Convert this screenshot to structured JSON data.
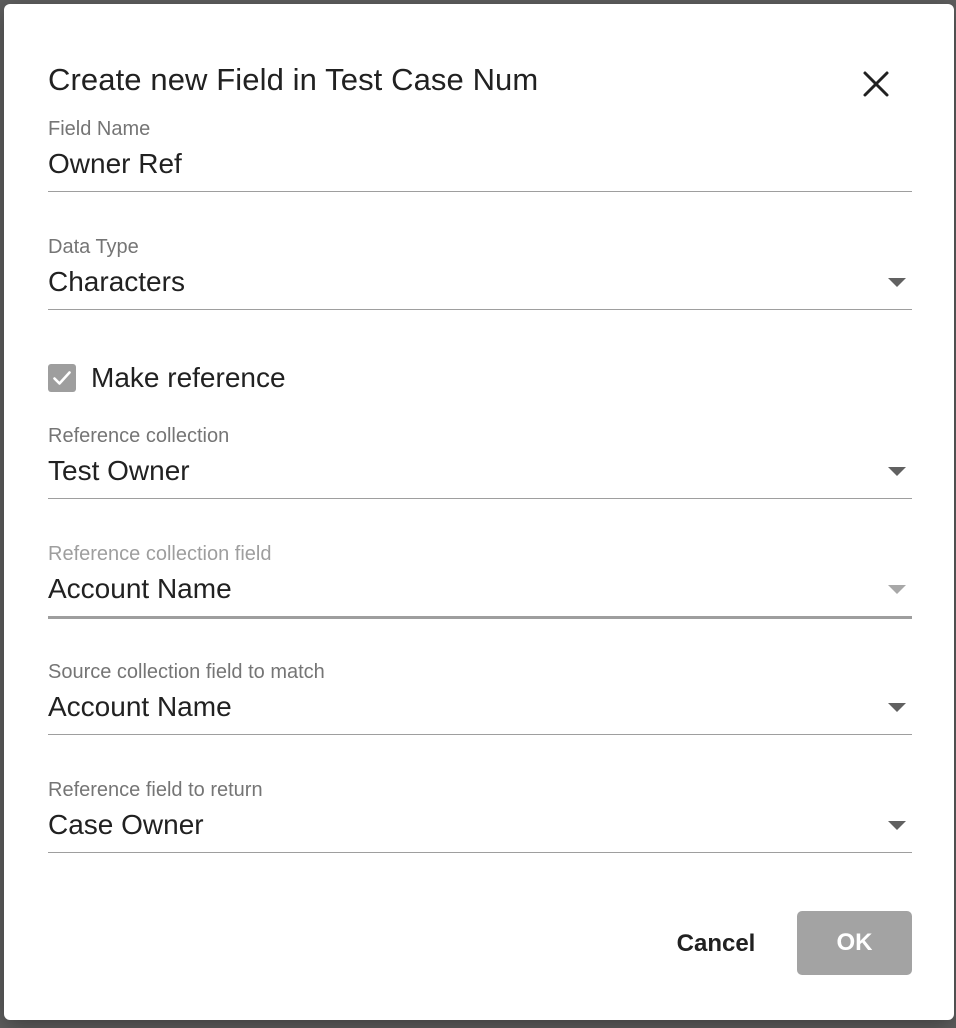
{
  "dialog": {
    "title": "Create new Field in Test Case Num",
    "close_icon": "close-icon"
  },
  "fields": {
    "field_name": {
      "label": "Field Name",
      "value": "Owner Ref"
    },
    "data_type": {
      "label": "Data Type",
      "value": "Characters"
    },
    "reference_collection": {
      "label": "Reference collection",
      "value": "Test Owner"
    },
    "reference_collection_field": {
      "label": "Reference collection field",
      "value": "Account Name"
    },
    "source_collection_field": {
      "label": "Source collection field to match",
      "value": "Account Name"
    },
    "reference_field_to_return": {
      "label": "Reference field to return",
      "value": "Case Owner"
    }
  },
  "make_reference": {
    "label": "Make reference",
    "checked": true,
    "icon": "check-icon"
  },
  "actions": {
    "cancel_label": "Cancel",
    "ok_label": "OK"
  },
  "colors": {
    "ok_button": "#a3a3a3",
    "checkbox": "#9e9e9e",
    "text": "#212121",
    "label": "#757575"
  }
}
